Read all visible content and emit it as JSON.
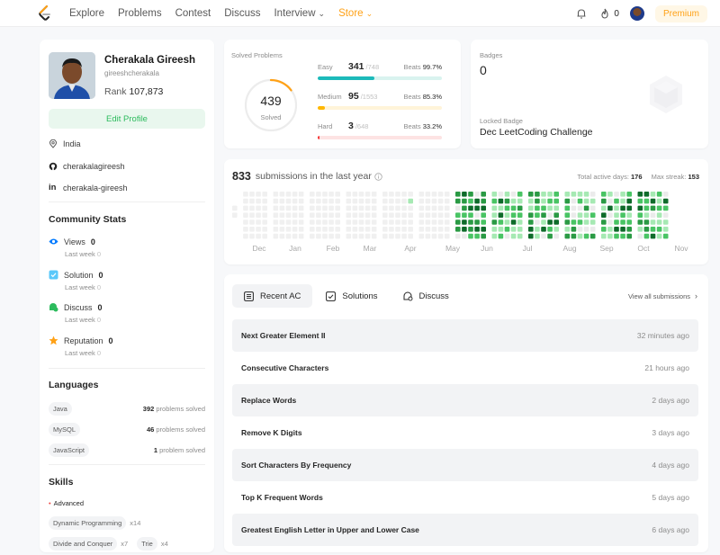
{
  "nav": {
    "links": [
      "Explore",
      "Problems",
      "Contest",
      "Discuss",
      "Interview",
      "Store"
    ],
    "streak": "0",
    "premium": "Premium"
  },
  "profile": {
    "name": "Cherakala Gireesh",
    "username": "gireeshcherakala",
    "rank_label": "Rank",
    "rank": "107,873",
    "edit_label": "Edit Profile",
    "location": "India",
    "github": "cherakalagireesh",
    "linkedin": "cherakala-gireesh"
  },
  "community": {
    "title": "Community Stats",
    "items": [
      {
        "label": "Views",
        "value": "0",
        "sub": "Last week",
        "subval": "0",
        "color": "#007aff"
      },
      {
        "label": "Solution",
        "value": "0",
        "sub": "Last week",
        "subval": "0",
        "color": "#5ac8fa"
      },
      {
        "label": "Discuss",
        "value": "0",
        "sub": "Last week",
        "subval": "0",
        "color": "#2cbb5d"
      },
      {
        "label": "Reputation",
        "value": "0",
        "sub": "Last week",
        "subval": "0",
        "color": "#ffa116"
      }
    ]
  },
  "languages": {
    "title": "Languages",
    "items": [
      {
        "name": "Java",
        "count": "392",
        "suffix": "problems solved"
      },
      {
        "name": "MySQL",
        "count": "46",
        "suffix": "problems solved"
      },
      {
        "name": "JavaScript",
        "count": "1",
        "suffix": "problem solved"
      }
    ]
  },
  "skills": {
    "title": "Skills",
    "level": "Advanced",
    "items": [
      {
        "name": "Dynamic Programming",
        "count": "x14"
      },
      {
        "name": "Divide and Conquer",
        "count": "x7"
      },
      {
        "name": "Trie",
        "count": "x4"
      }
    ]
  },
  "solved": {
    "title": "Solved Problems",
    "total": "439",
    "total_label": "Solved",
    "total_value": 439,
    "total_max": 2949,
    "beats_label": "Beats",
    "levels": [
      {
        "label": "Easy",
        "count": "341",
        "total": "/748",
        "beats": "99.7%",
        "fraction": 0.456,
        "color": "#1cbaba",
        "track": "#d9f3ef"
      },
      {
        "label": "Medium",
        "count": "95",
        "total": "/1553",
        "beats": "85.3%",
        "fraction": 0.061,
        "color": "#ffb700",
        "track": "#fff4d9"
      },
      {
        "label": "Hard",
        "count": "3",
        "total": "/648",
        "beats": "33.2%",
        "fraction": 0.005,
        "color": "#f63737",
        "track": "#fde3e3"
      }
    ]
  },
  "badges": {
    "title": "Badges",
    "count": "0",
    "locked_label": "Locked Badge",
    "locked_name": "Dec LeetCoding Challenge"
  },
  "calendar": {
    "count": "833",
    "label": "submissions in the last year",
    "active_label": "Total active days:",
    "active": "176",
    "streak_label": "Max streak:",
    "streak": "153",
    "months": [
      "Dec",
      "Jan",
      "Feb",
      "Mar",
      "Apr",
      "May",
      "Jun",
      "Jul",
      "Aug",
      "Sep",
      "Oct",
      "Nov"
    ],
    "colors": [
      "#ebebeb",
      "#a6e9b3",
      "#49c464",
      "#2a9a44",
      "#0e6b2a"
    ]
  },
  "recent": {
    "tabs": [
      "Recent AC",
      "Solutions",
      "Discuss"
    ],
    "view_all": "View all submissions",
    "items": [
      {
        "title": "Next Greater Element II",
        "time": "32 minutes ago"
      },
      {
        "title": "Consecutive Characters",
        "time": "21 hours ago"
      },
      {
        "title": "Replace Words",
        "time": "2 days ago"
      },
      {
        "title": "Remove K Digits",
        "time": "3 days ago"
      },
      {
        "title": "Sort Characters By Frequency",
        "time": "4 days ago"
      },
      {
        "title": "Top K Frequent Words",
        "time": "5 days ago"
      },
      {
        "title": "Greatest English Letter in Upper and Lower Case",
        "time": "6 days ago"
      }
    ]
  }
}
